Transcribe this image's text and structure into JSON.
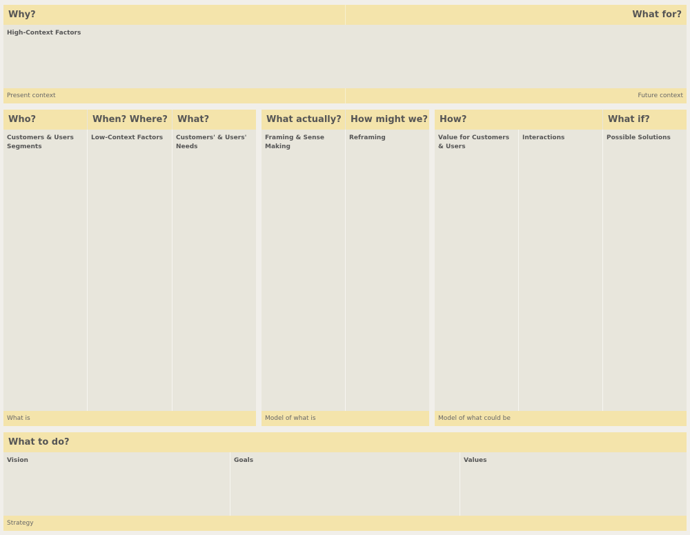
{
  "top": {
    "why_title": "Why?",
    "what_for_title": "What for?",
    "high_context_label": "High-Context Factors",
    "present_context": "Present context",
    "future_context": "Future context"
  },
  "left": {
    "who_title": "Who?",
    "when_where_title": "When? Where?",
    "what_title": "What?",
    "customers_segments_label": "Customers & Users Segments",
    "low_context_label": "Low-Context Factors",
    "needs_label": "Customers' & Users' Needs",
    "footer": "What is"
  },
  "middle": {
    "what_actually_title": "What actually?",
    "how_might_we_title": "How might we?",
    "framing_label": "Framing & Sense Making",
    "reframing_label": "Reframing",
    "footer": "Model of what is"
  },
  "right": {
    "how_title": "How?",
    "what_if_title": "What if?",
    "value_label": "Value for Customers & Users",
    "interactions_label": "Interactions",
    "solutions_label": "Possible Solutions",
    "footer": "Model of what could be"
  },
  "bottom": {
    "what_to_do_title": "What to do?",
    "vision_label": "Vision",
    "goals_label": "Goals",
    "values_label": "Values",
    "footer": "Strategy"
  },
  "colors": {
    "header": "#f4e4ab",
    "panel": "#e8e6dc",
    "background": "#f1efea",
    "text": "#555555"
  }
}
